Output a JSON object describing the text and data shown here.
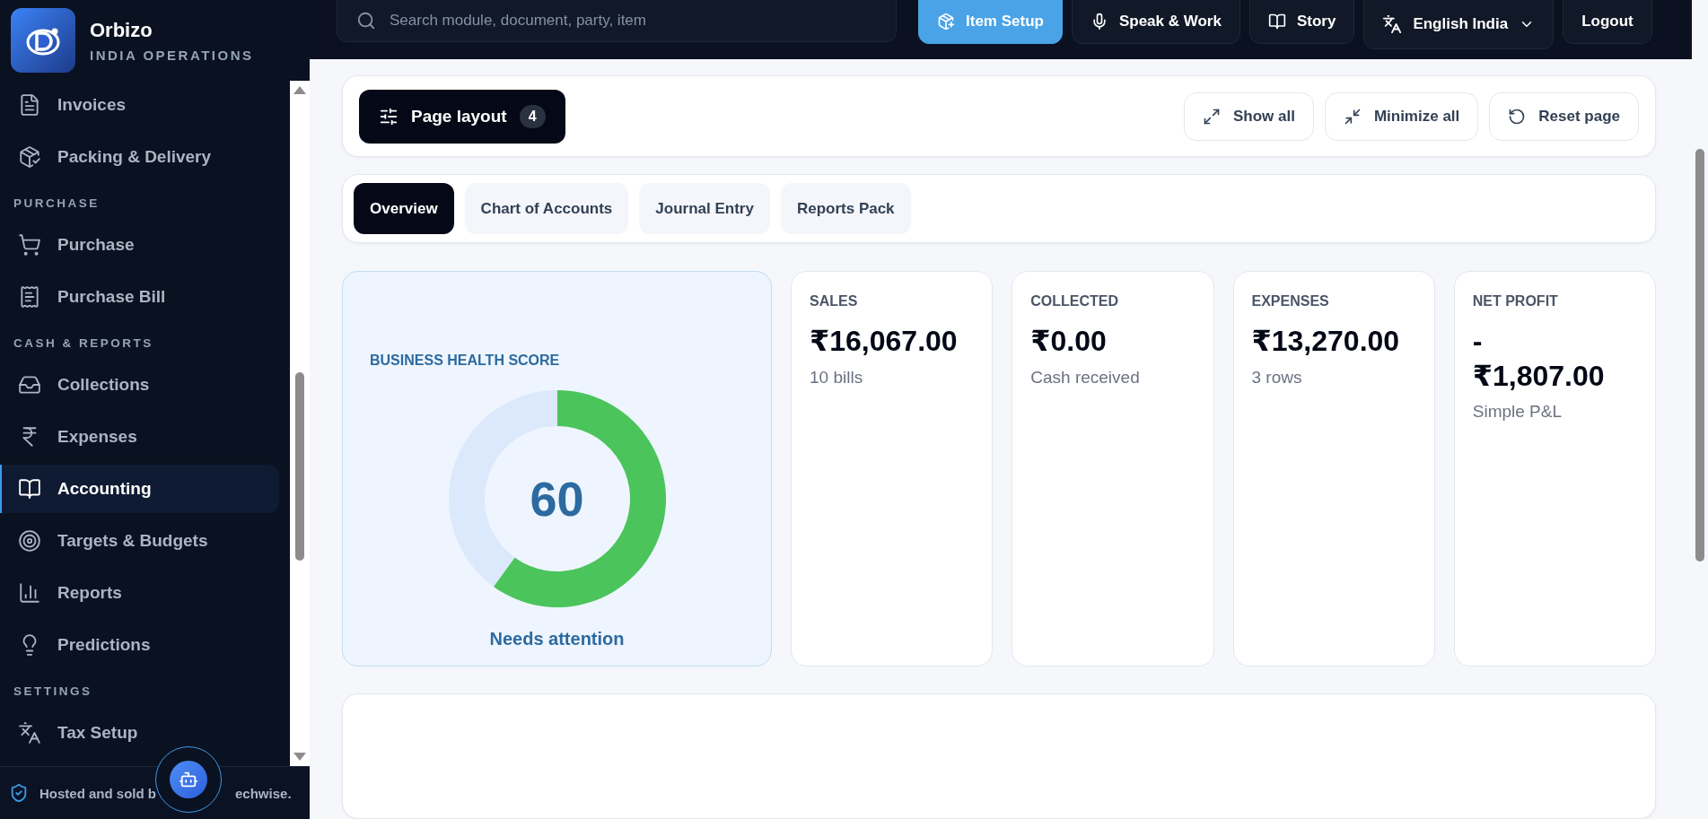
{
  "brand": {
    "name": "Orbizo",
    "subtitle": "INDIA OPERATIONS"
  },
  "sidebar": {
    "items": [
      {
        "kind": "link",
        "label": "Invoices",
        "selected": false
      },
      {
        "kind": "link",
        "label": "Packing & Delivery",
        "selected": false
      },
      {
        "kind": "section",
        "label": "PURCHASE"
      },
      {
        "kind": "link",
        "label": "Purchase",
        "selected": false
      },
      {
        "kind": "link",
        "label": "Purchase Bill",
        "selected": false
      },
      {
        "kind": "section",
        "label": "CASH & REPORTS"
      },
      {
        "kind": "link",
        "label": "Collections",
        "selected": false
      },
      {
        "kind": "link",
        "label": "Expenses",
        "selected": false
      },
      {
        "kind": "link",
        "label": "Accounting",
        "selected": true
      },
      {
        "kind": "link",
        "label": "Targets & Budgets",
        "selected": false
      },
      {
        "kind": "link",
        "label": "Reports",
        "selected": false
      },
      {
        "kind": "link",
        "label": "Predictions",
        "selected": false
      },
      {
        "kind": "section",
        "label": "SETTINGS"
      },
      {
        "kind": "link",
        "label": "Tax Setup",
        "selected": false
      }
    ]
  },
  "footer": {
    "text_before": "Hosted and sold b",
    "text_after": "echwise."
  },
  "search": {
    "placeholder": "Search module, document, party, item"
  },
  "top_actions": [
    {
      "kind": "primary",
      "label": "Item Setup"
    },
    {
      "kind": "plain",
      "label": "Speak & Work"
    },
    {
      "kind": "plain",
      "label": "Story"
    },
    {
      "kind": "language",
      "label": "English India"
    },
    {
      "kind": "text",
      "label": "Logout"
    }
  ],
  "page_layout": {
    "label": "Page layout",
    "count": "4"
  },
  "layout_actions": [
    "Show all",
    "Minimize all",
    "Reset page"
  ],
  "tabs": [
    {
      "label": "Overview",
      "selected": true
    },
    {
      "label": "Chart of Accounts",
      "selected": false
    },
    {
      "label": "Journal Entry",
      "selected": false
    },
    {
      "label": "Reports Pack",
      "selected": false
    }
  ],
  "health": {
    "title": "BUSINESS HEALTH SCORE",
    "score": "60",
    "chart_data": {
      "type": "donut",
      "values": [
        60,
        40
      ]
    },
    "status": "Needs attention"
  },
  "stats": [
    {
      "label": "SALES",
      "value": "₹16,067.00",
      "note": "10 bills"
    },
    {
      "label": "COLLECTED",
      "value": "₹0.00",
      "note": "Cash received"
    },
    {
      "label": "EXPENSES",
      "value": "₹13,270.00",
      "note": "3 rows"
    },
    {
      "label": "NET PROFIT",
      "value": "-₹1,807.00",
      "note": "Simple P&L"
    }
  ]
}
